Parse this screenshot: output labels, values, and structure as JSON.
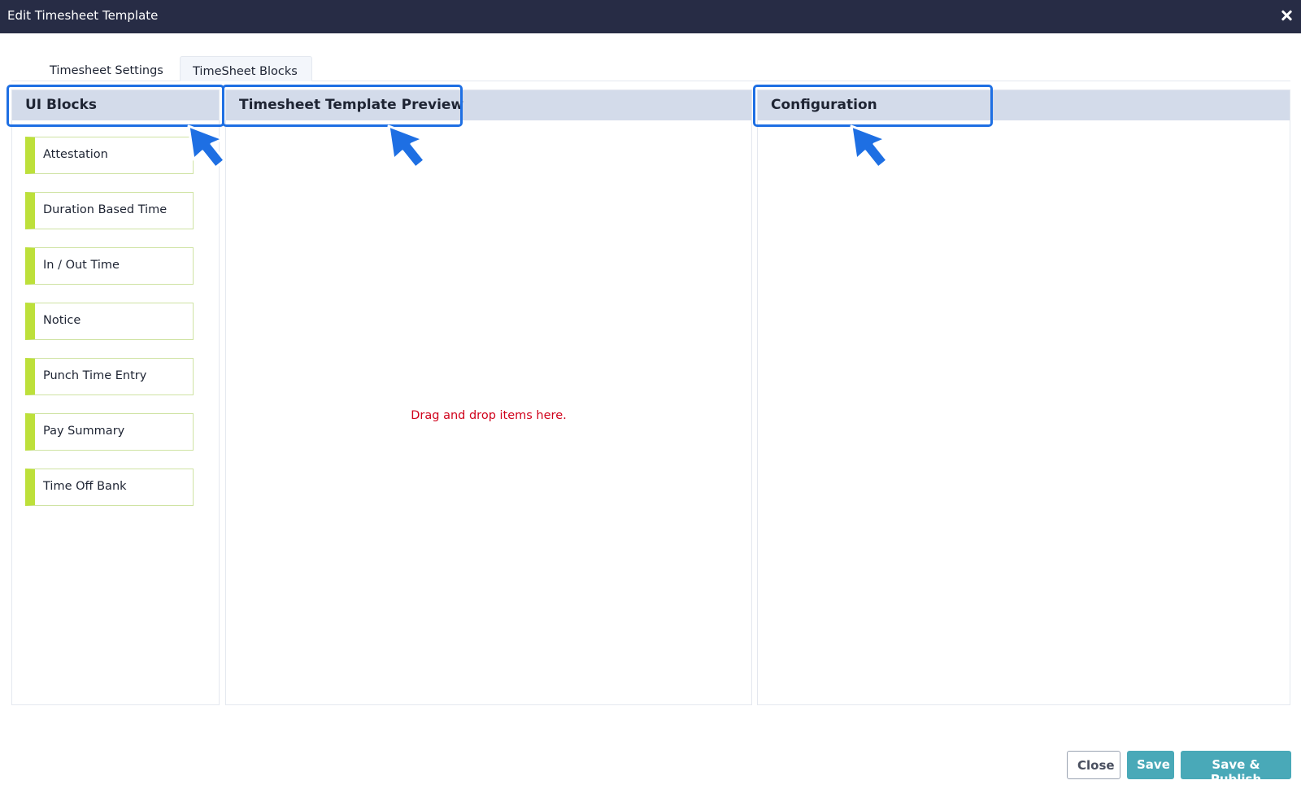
{
  "window": {
    "title": "Edit Timesheet Template",
    "close_icon": "close-icon"
  },
  "tabs": [
    {
      "label": "Timesheet Settings",
      "active": false
    },
    {
      "label": "TimeSheet Blocks",
      "active": true
    }
  ],
  "panels": {
    "ui_blocks": {
      "title": "UI Blocks",
      "items": [
        {
          "label": "Attestation"
        },
        {
          "label": "Duration Based Time"
        },
        {
          "label": "In / Out Time"
        },
        {
          "label": "Notice"
        },
        {
          "label": "Punch Time Entry"
        },
        {
          "label": "Pay Summary"
        },
        {
          "label": "Time Off Bank"
        }
      ]
    },
    "preview": {
      "title": "Timesheet Template Preview",
      "empty_message": "Drag and drop items here."
    },
    "configuration": {
      "title": "Configuration"
    }
  },
  "footer": {
    "close_label": "Close",
    "save_label": "Save",
    "publish_label": "Save & Publish"
  },
  "colors": {
    "titlebar": "#272c45",
    "panel_header": "#d3dbea",
    "block_accent": "#bde03a",
    "callout": "#1e6fe3",
    "empty_message": "#d0021b",
    "button": "#49a9b8"
  }
}
